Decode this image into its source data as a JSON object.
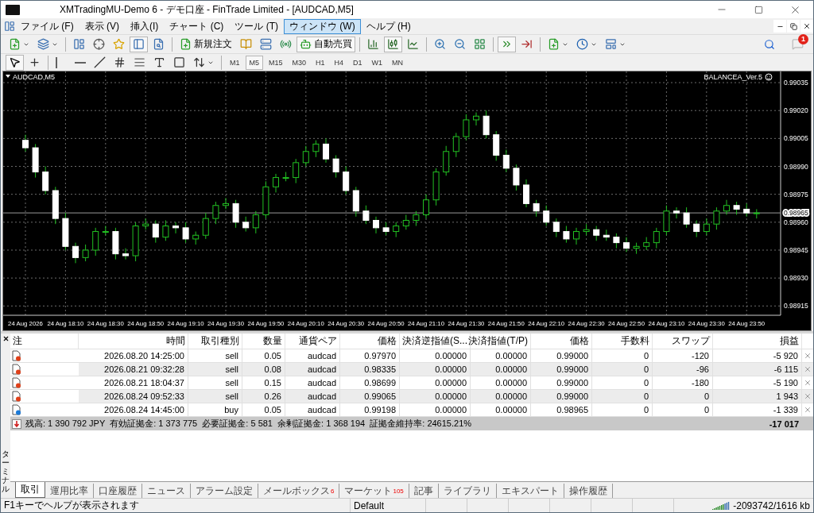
{
  "window": {
    "title": "XMTradingMU-Demo 6 - デモ口座 - FinTrade Limited - [AUDCAD,M5]"
  },
  "menu": [
    {
      "label": "ファイル (F)",
      "selected": false
    },
    {
      "label": "表示 (V)",
      "selected": false
    },
    {
      "label": "挿入(I)",
      "selected": false
    },
    {
      "label": "チャート (C)",
      "selected": false
    },
    {
      "label": "ツール (T)",
      "selected": false
    },
    {
      "label": "ウィンドウ (W)",
      "selected": true
    },
    {
      "label": "ヘルプ (H)",
      "selected": false
    }
  ],
  "toolbar": [
    {
      "kind": "newchart",
      "pressed": false
    },
    {
      "kind": "profiles",
      "pressed": false
    },
    {
      "kind": "sep"
    },
    {
      "kind": "market",
      "pressed": false
    },
    {
      "kind": "crosshair",
      "pressed": false
    },
    {
      "kind": "favorites",
      "pressed": false
    },
    {
      "kind": "navigator",
      "pressed": true
    },
    {
      "kind": "tester",
      "pressed": false
    },
    {
      "kind": "sep"
    },
    {
      "kind": "order",
      "label": "新規注文",
      "pressed": false
    },
    {
      "kind": "editor",
      "pressed": false
    },
    {
      "kind": "server",
      "pressed": false
    },
    {
      "kind": "signals",
      "pressed": false
    },
    {
      "kind": "algo",
      "label": "自動売買",
      "pressed": true
    },
    {
      "kind": "sep"
    },
    {
      "kind": "bars",
      "pressed": false
    },
    {
      "kind": "candles",
      "pressed": true
    },
    {
      "kind": "line",
      "pressed": false
    },
    {
      "kind": "sep"
    },
    {
      "kind": "zoomin",
      "pressed": false
    },
    {
      "kind": "zoomout",
      "pressed": false
    },
    {
      "kind": "tile",
      "pressed": false
    },
    {
      "kind": "sep"
    },
    {
      "kind": "autoscroll",
      "pressed": true
    },
    {
      "kind": "shift",
      "pressed": false
    },
    {
      "kind": "sep"
    },
    {
      "kind": "indicators",
      "pressed": false
    },
    {
      "kind": "periods",
      "pressed": false
    },
    {
      "kind": "templates",
      "pressed": false
    }
  ],
  "notifications": {
    "badge": "1"
  },
  "draw_toolbar": [
    {
      "kind": "cursor",
      "pressed": true
    },
    {
      "kind": "cross",
      "pressed": false
    },
    {
      "kind": "sep"
    },
    {
      "kind": "vline",
      "pressed": false
    },
    {
      "kind": "hline",
      "pressed": false
    },
    {
      "kind": "trend",
      "pressed": false
    },
    {
      "kind": "channel",
      "pressed": false
    },
    {
      "kind": "fibo",
      "pressed": false
    },
    {
      "kind": "text",
      "pressed": false
    },
    {
      "kind": "label",
      "pressed": false
    },
    {
      "kind": "arrows",
      "pressed": false
    },
    {
      "kind": "sep"
    }
  ],
  "timeframes": [
    {
      "label": "M1",
      "selected": false
    },
    {
      "label": "M5",
      "selected": true
    },
    {
      "label": "M15",
      "selected": false
    },
    {
      "label": "M30",
      "selected": false
    },
    {
      "label": "H1",
      "selected": false
    },
    {
      "label": "H4",
      "selected": false
    },
    {
      "label": "D1",
      "selected": false
    },
    {
      "label": "W1",
      "selected": false
    },
    {
      "label": "MN",
      "selected": false
    }
  ],
  "chart": {
    "symbol": "AUDCAD,M5",
    "expert": "BALANCEA_Ver.5",
    "chart_data": {
      "type": "candlestick",
      "grid": true,
      "ref_lines": [
        {
          "axis": "y",
          "value": 0.98965,
          "label": "0.98965"
        }
      ],
      "categories": [
        "24 Aug 2026",
        null,
        null,
        null,
        "24 Aug 18:10",
        null,
        null,
        null,
        "24 Aug 18:30",
        null,
        null,
        null,
        "24 Aug 18:50",
        null,
        null,
        null,
        "24 Aug 19:10",
        null,
        null,
        null,
        "24 Aug 19:30",
        null,
        null,
        null,
        "24 Aug 19:50",
        null,
        null,
        null,
        "24 Aug 20:10",
        null,
        null,
        null,
        "24 Aug 20:30",
        null,
        null,
        null,
        "24 Aug 20:50",
        null,
        null,
        null,
        "24 Aug 21:10",
        null,
        null,
        null,
        "24 Aug 21:30",
        null,
        null,
        null,
        "24 Aug 21:50",
        null,
        null,
        null,
        "24 Aug 22:10",
        null,
        null,
        null,
        "24 Aug 22:30",
        null,
        null,
        null,
        "24 Aug 22:50",
        null,
        null,
        null,
        "24 Aug 23:10",
        null,
        null,
        null,
        "24 Aug 23:30",
        null,
        null,
        null,
        "24 Aug 23:50",
        null
      ],
      "ohlc": [
        [
          0.99004,
          0.99007,
          0.98998,
          0.99
        ],
        [
          0.99,
          0.99002,
          0.98984,
          0.98987
        ],
        [
          0.98987,
          0.9899,
          0.98975,
          0.98977
        ],
        [
          0.98977,
          0.98979,
          0.98959,
          0.98962
        ],
        [
          0.98962,
          0.98965,
          0.98945,
          0.98947
        ],
        [
          0.98947,
          0.98949,
          0.98938,
          0.98941
        ],
        [
          0.98941,
          0.98948,
          0.98939,
          0.98945
        ],
        [
          0.98945,
          0.98957,
          0.98942,
          0.98955
        ],
        [
          0.98955,
          0.98958,
          0.98953,
          0.98955
        ],
        [
          0.98955,
          0.98957,
          0.9894,
          0.98943
        ],
        [
          0.98943,
          0.98946,
          0.9894,
          0.98942
        ],
        [
          0.98942,
          0.9896,
          0.98939,
          0.98958
        ],
        [
          0.98958,
          0.98962,
          0.98956,
          0.98959
        ],
        [
          0.98959,
          0.98961,
          0.98949,
          0.98952
        ],
        [
          0.98952,
          0.98961,
          0.9895,
          0.98958
        ],
        [
          0.98958,
          0.9896,
          0.98954,
          0.98957
        ],
        [
          0.98957,
          0.9896,
          0.98949,
          0.98951
        ],
        [
          0.98951,
          0.98955,
          0.98948,
          0.98953
        ],
        [
          0.98953,
          0.98965,
          0.98951,
          0.98962
        ],
        [
          0.98962,
          0.98971,
          0.98959,
          0.98969
        ],
        [
          0.98969,
          0.98973,
          0.98967,
          0.9897
        ],
        [
          0.9897,
          0.98972,
          0.98957,
          0.9896
        ],
        [
          0.9896,
          0.98963,
          0.98955,
          0.98957
        ],
        [
          0.98957,
          0.98966,
          0.98954,
          0.98964
        ],
        [
          0.98964,
          0.98982,
          0.98962,
          0.98979
        ],
        [
          0.98979,
          0.98986,
          0.98976,
          0.98984
        ],
        [
          0.98984,
          0.98987,
          0.98982,
          0.98984
        ],
        [
          0.98984,
          0.98994,
          0.98981,
          0.98992
        ],
        [
          0.98992,
          0.99001,
          0.9899,
          0.98998
        ],
        [
          0.98998,
          0.99004,
          0.98995,
          0.99002
        ],
        [
          0.99002,
          0.99005,
          0.98992,
          0.98994
        ],
        [
          0.98994,
          0.98996,
          0.98984,
          0.98987
        ],
        [
          0.98987,
          0.9899,
          0.98975,
          0.98977
        ],
        [
          0.98977,
          0.98979,
          0.98963,
          0.98966
        ],
        [
          0.98966,
          0.98969,
          0.98959,
          0.98961
        ],
        [
          0.98961,
          0.98963,
          0.98954,
          0.98957
        ],
        [
          0.98957,
          0.9896,
          0.98953,
          0.98955
        ],
        [
          0.98955,
          0.9896,
          0.98952,
          0.98958
        ],
        [
          0.98958,
          0.98964,
          0.98956,
          0.98961
        ],
        [
          0.98961,
          0.98966,
          0.98958,
          0.98964
        ],
        [
          0.98964,
          0.98975,
          0.98962,
          0.98972
        ],
        [
          0.98972,
          0.98989,
          0.98969,
          0.98987
        ],
        [
          0.98987,
          0.99001,
          0.98985,
          0.98998
        ],
        [
          0.98998,
          0.99008,
          0.98995,
          0.99006
        ],
        [
          0.99006,
          0.99018,
          0.99004,
          0.99015
        ],
        [
          0.99015,
          0.99019,
          0.99012,
          0.99017
        ],
        [
          0.99017,
          0.9902,
          0.99005,
          0.99007
        ],
        [
          0.99007,
          0.99009,
          0.98993,
          0.98996
        ],
        [
          0.98996,
          0.98999,
          0.98987,
          0.98989
        ],
        [
          0.98989,
          0.98991,
          0.98977,
          0.9898
        ],
        [
          0.9898,
          0.98983,
          0.98968,
          0.9897
        ],
        [
          0.9897,
          0.98972,
          0.98963,
          0.98966
        ],
        [
          0.98966,
          0.98969,
          0.98958,
          0.9896
        ],
        [
          0.9896,
          0.98962,
          0.98952,
          0.98955
        ],
        [
          0.98955,
          0.98958,
          0.98949,
          0.98951
        ],
        [
          0.98951,
          0.98957,
          0.98948,
          0.98955
        ],
        [
          0.98955,
          0.98959,
          0.98953,
          0.98956
        ],
        [
          0.98956,
          0.98958,
          0.9895,
          0.98953
        ],
        [
          0.98953,
          0.98956,
          0.9895,
          0.98952
        ],
        [
          0.98952,
          0.98954,
          0.98946,
          0.98949
        ],
        [
          0.98949,
          0.98952,
          0.98944,
          0.98946
        ],
        [
          0.98946,
          0.98949,
          0.98943,
          0.98947
        ],
        [
          0.98947,
          0.98952,
          0.98945,
          0.98949
        ],
        [
          0.98949,
          0.98957,
          0.98946,
          0.98955
        ],
        [
          0.98955,
          0.98969,
          0.98953,
          0.98966
        ],
        [
          0.98966,
          0.98968,
          0.98962,
          0.98965
        ],
        [
          0.98965,
          0.98968,
          0.98957,
          0.98959
        ],
        [
          0.98959,
          0.98961,
          0.98952,
          0.98955
        ],
        [
          0.98955,
          0.98962,
          0.98953,
          0.98959
        ],
        [
          0.98959,
          0.98968,
          0.98956,
          0.98966
        ],
        [
          0.98966,
          0.98972,
          0.98964,
          0.98969
        ],
        [
          0.98969,
          0.98971,
          0.98964,
          0.98967
        ],
        [
          0.98967,
          0.9897,
          0.98963,
          0.98965
        ],
        [
          0.98965,
          0.98967,
          0.98962,
          0.98965
        ]
      ],
      "ylim": [
        0.9891,
        0.99041
      ],
      "yticks": [
        {
          "value": 0.99035,
          "label": "0.99035"
        },
        {
          "value": 0.9902,
          "label": "0.99020"
        },
        {
          "value": 0.99005,
          "label": "0.99005"
        },
        {
          "value": 0.9899,
          "label": "0.98990"
        },
        {
          "value": 0.98975,
          "label": "0.98975"
        },
        {
          "value": 0.9896,
          "label": "0.98960"
        },
        {
          "value": 0.98945,
          "label": "0.98945"
        },
        {
          "value": 0.9893,
          "label": "0.98930"
        },
        {
          "value": 0.98915,
          "label": "0.98915"
        }
      ]
    }
  },
  "terminal": {
    "title": "ターミナル",
    "columns": [
      "注",
      "時間",
      "取引種別",
      "数量",
      "通貨ペア",
      "価格",
      "決済逆指値(S...",
      "決済指値(T/P)",
      "価格",
      "手数料",
      "スワップ",
      "損益"
    ],
    "rows": [
      {
        "kind": "sell",
        "cells": [
          "",
          "2026.08.20 14:25:00",
          "sell",
          "0.05",
          "audcad",
          "0.97970",
          "0.00000",
          "0.00000",
          "0.99000",
          "0",
          "-120",
          "-5 920"
        ]
      },
      {
        "kind": "sell",
        "cells": [
          "",
          "2026.08.21 09:32:28",
          "sell",
          "0.08",
          "audcad",
          "0.98335",
          "0.00000",
          "0.00000",
          "0.99000",
          "0",
          "-96",
          "-6 115"
        ]
      },
      {
        "kind": "sell",
        "cells": [
          "",
          "2026.08.21 18:04:37",
          "sell",
          "0.15",
          "audcad",
          "0.98699",
          "0.00000",
          "0.00000",
          "0.99000",
          "0",
          "-180",
          "-5 190"
        ]
      },
      {
        "kind": "sell",
        "cells": [
          "",
          "2026.08.24 09:52:33",
          "sell",
          "0.26",
          "audcad",
          "0.99065",
          "0.00000",
          "0.00000",
          "0.99000",
          "0",
          "0",
          "1 943"
        ]
      },
      {
        "kind": "buy",
        "cells": [
          "",
          "2026.08.24 14:45:00",
          "buy",
          "0.05",
          "audcad",
          "0.99198",
          "0.00000",
          "0.00000",
          "0.98965",
          "0",
          "0",
          "-1 339"
        ]
      }
    ],
    "summary": "残高: 1 390 792 JPY  有効証拠金: 1 373 775  必要証拠金: 5 581  余剰証拠金: 1 368 194  証拠金維持率: 24615.21%",
    "total": "-17 017",
    "tabs": [
      {
        "label": "取引",
        "selected": true
      },
      {
        "label": "運用比率",
        "selected": false
      },
      {
        "label": "口座履歴",
        "selected": false
      },
      {
        "label": "ニュース",
        "selected": false
      },
      {
        "label": "アラーム設定",
        "selected": false
      },
      {
        "label": "メールボックス",
        "badge": "6",
        "selected": false
      },
      {
        "label": "マーケット",
        "badge": "105",
        "selected": false
      },
      {
        "label": "記事",
        "selected": false
      },
      {
        "label": "ライブラリ",
        "selected": false
      },
      {
        "label": "エキスパート",
        "selected": false
      },
      {
        "label": "操作履歴",
        "selected": false
      }
    ]
  },
  "status_bar": {
    "help": "F1キーでヘルプが表示されます",
    "profile": "Default",
    "memory": "-2093742/1616 kb"
  }
}
